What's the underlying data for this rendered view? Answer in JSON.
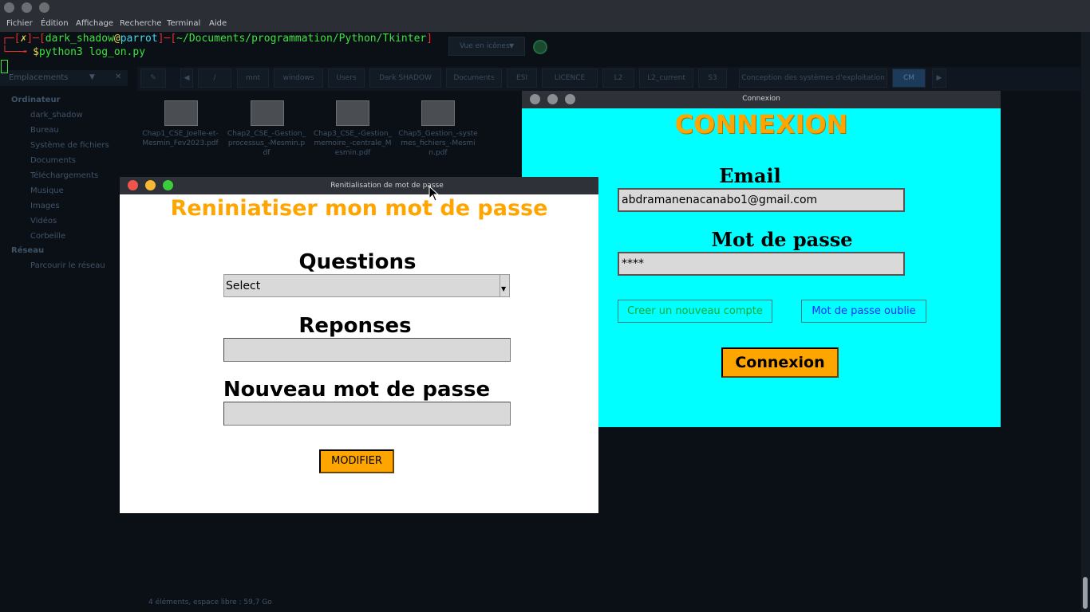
{
  "terminal": {
    "menu": [
      "Fichier",
      "Édition",
      "Affichage",
      "Recherche",
      "Terminal",
      "Aide"
    ],
    "prompt": {
      "corner_top": "┌─[",
      "status": "✗",
      "sep1": "]─[",
      "user": "dark_shadow",
      "at": "@",
      "host": "parrot",
      "sep2": "]─[",
      "path": "~/Documents/programmation/Python/Tkinter",
      "close": "]",
      "corner_bottom": "└──╼ ",
      "dollar": "$",
      "command": "python3 log_on.py"
    },
    "colors": {
      "red": "#e0312b",
      "green": "#3fe03f",
      "cyan": "#44d7e8",
      "yellow": "#e8d84a"
    }
  },
  "file_manager": {
    "toolbar_view": "Vue en icônes",
    "sidebar_header": "Emplacements",
    "sidebar_sections": [
      "Ordinateur",
      "Réseau"
    ],
    "sidebar_items": [
      "dark_shadow",
      "Bureau",
      "Système de fichiers",
      "Documents",
      "Téléchargements",
      "Musique",
      "Images",
      "Vidéos",
      "Corbeille"
    ],
    "network_item": "Parcourir le réseau",
    "breadcrumbs": [
      "mnt",
      "windows",
      "Users",
      "Dark SHADOW",
      "Documents",
      "ESI",
      "LICENCE",
      "L2",
      "L2_current",
      "S3",
      "Conception des systèmes d'exploitation",
      "CM"
    ],
    "files": [
      {
        "name": "Chap1_CSE_Joelle-et-Mesmin_Fev2023.pdf"
      },
      {
        "name": "Chap2_CSE_-Gestion_processus_-Mesmin.pdf"
      },
      {
        "name": "Chap3_CSE_-Gestion_memoire_-centrale_Mesmin.pdf"
      },
      {
        "name": "Chap5_Gestion_-systemes_fichiers_-Mesmin.pdf"
      }
    ],
    "status": "4 éléments, espace libre : 59,7 Go"
  },
  "connexion_window": {
    "title": "Connexion",
    "heading": "CONNEXION",
    "email_label": "Email",
    "email_value": "abdramanenacanabo1@gmail.com",
    "password_label": "Mot de passe",
    "password_value": "****",
    "create_account": "Creer un nouveau compte",
    "forgot_password": "Mot de passe oublie",
    "submit": "Connexion",
    "colors": {
      "bg": "#00ffff",
      "heading": "#ffa500",
      "button": "#ffa500",
      "create_text": "#16a82e",
      "forgot_text": "#1a2cff"
    }
  },
  "reset_window": {
    "title": "Renitialisation de mot de passe",
    "heading": "Reniniatiser mon mot de passe",
    "questions_label": "Questions",
    "questions_selected": "Select",
    "answers_label": "Reponses",
    "answers_value": "",
    "new_password_label": "Nouveau mot de passe",
    "new_password_value": "",
    "submit": "MODIFIER",
    "colors": {
      "heading": "#ffa500",
      "button": "#ffa500",
      "close": "#f0544d",
      "minimize": "#f7b733",
      "maximize": "#3bcd3b"
    }
  }
}
